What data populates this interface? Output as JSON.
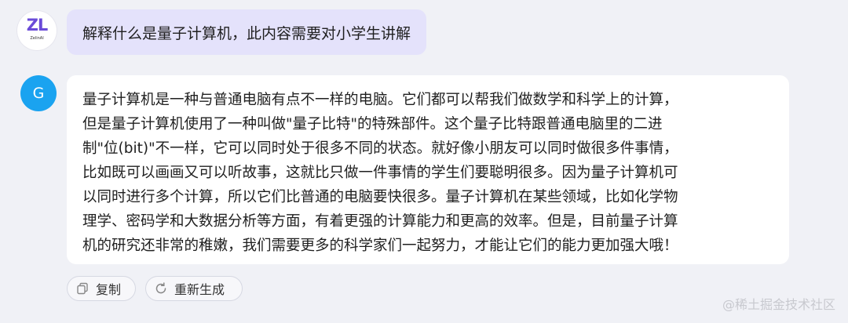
{
  "user": {
    "avatar_logo": "ZL",
    "avatar_sub": "ZelinAI",
    "message": "解释什么是量子计算机，此内容需要对小学生讲解"
  },
  "assistant": {
    "avatar_letter": "G",
    "lines": [
      "量子计算机是一种与普通电脑有点不一样的电脑。它们都可以帮我们做数学和科学上的计算，",
      "但是量子计算机使用了一种叫做\"量子比特\"的特殊部件。这个量子比特跟普通电脑里的二进",
      "制\"位(bit)\"不一样，它可以同时处于很多不同的状态。就好像小朋友可以同时做很多件事情，",
      "比如既可以画画又可以听故事，这就比只做一件事情的学生们要聪明很多。因为量子计算机可",
      "以同时进行多个计算，所以它们比普通的电脑要快很多。量子计算机在某些领域，比如化学物",
      "理学、密码学和大数据分析等方面，有着更强的计算能力和更高的效率。但是，目前量子计算",
      "机的研究还非常的稚嫩，我们需要更多的科学家们一起努力，才能让它们的能力更加强大哦！"
    ]
  },
  "actions": {
    "copy_label": "复制",
    "regenerate_label": "重新生成"
  },
  "watermark": "@稀土掘金技术社区"
}
